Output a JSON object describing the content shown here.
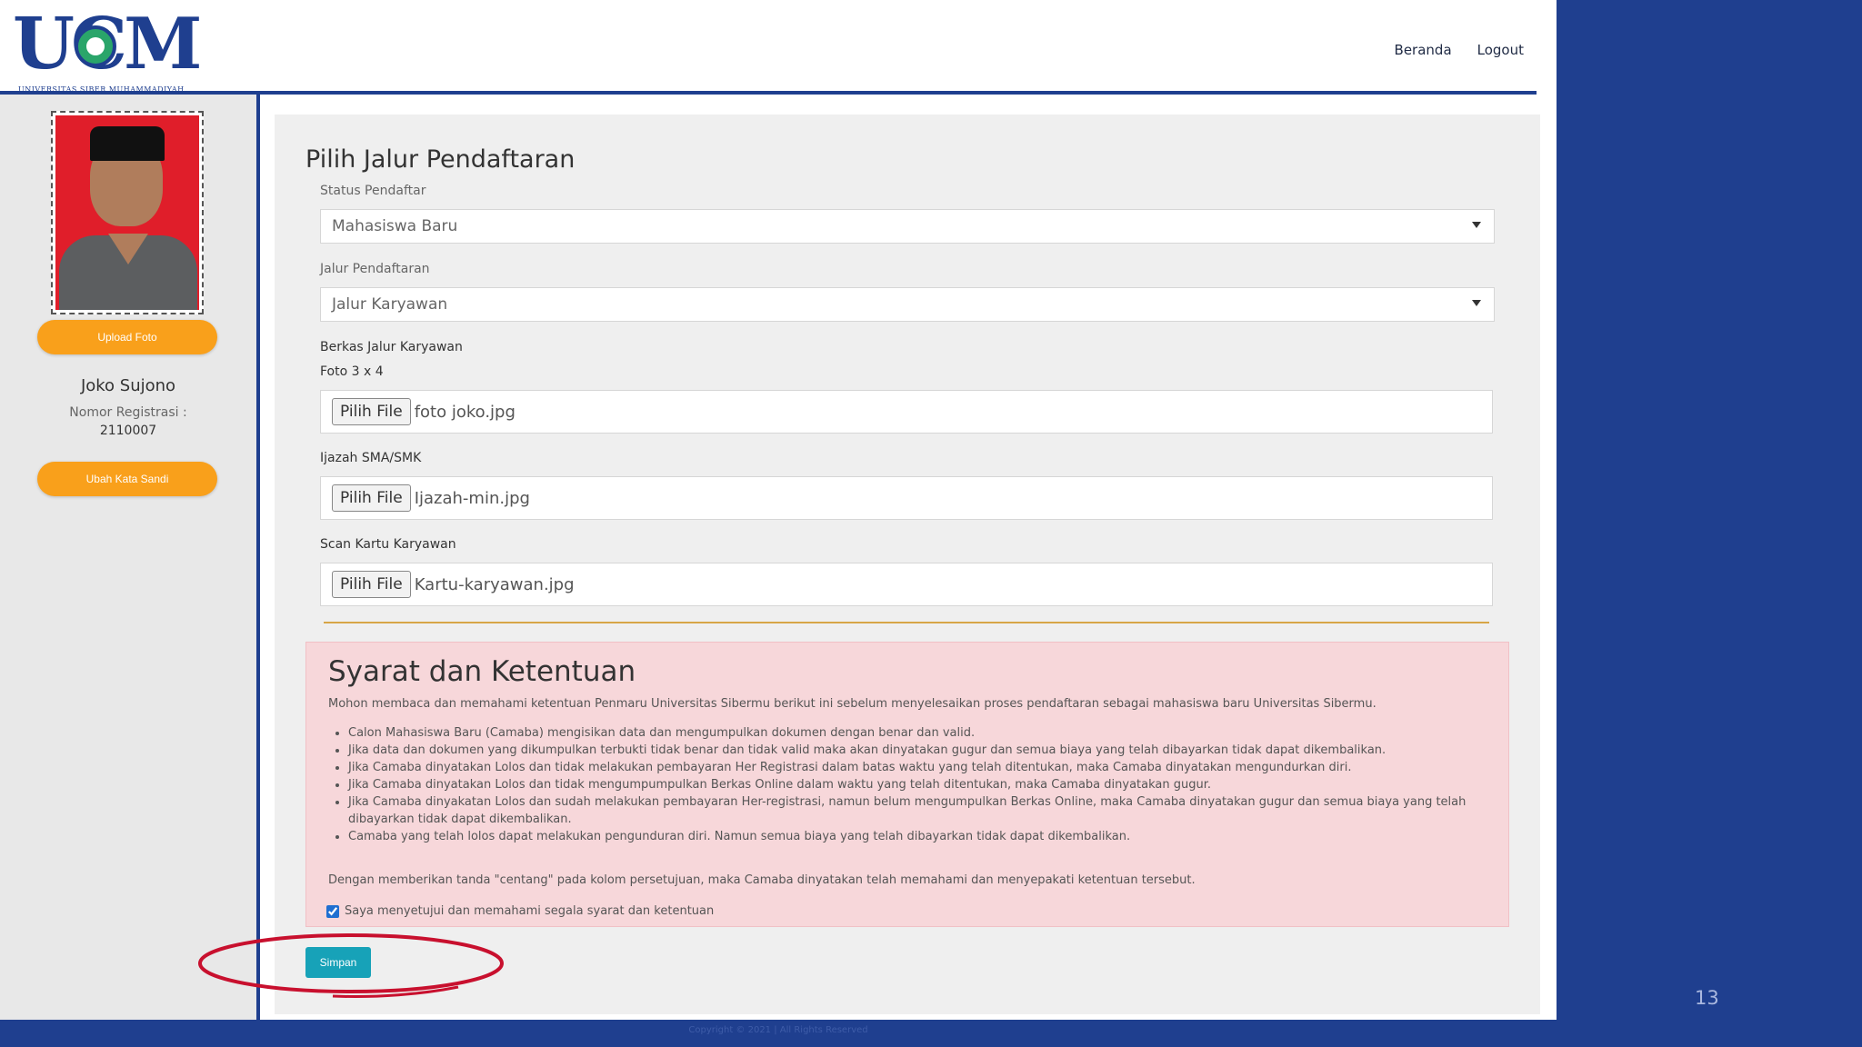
{
  "header": {
    "logo_text": "UCM",
    "logo_sub": "UNIVERSITAS SIBER MUHAMMADIYAH",
    "nav": [
      "Beranda",
      "Logout"
    ]
  },
  "sidebar": {
    "upload_label": "Upload Foto",
    "user_name": "Joko Sujono",
    "reg_label": "Nomor Registrasi :",
    "reg_value": "2110007",
    "change_password_label": "Ubah Kata Sandi"
  },
  "form": {
    "title": "Pilih Jalur Pendaftaran",
    "status_label": "Status Pendaftar",
    "status_value": "Mahasiswa Baru",
    "path_label": "Jalur Pendaftaran",
    "path_value": "Jalur Karyawan",
    "files_heading": "Berkas Jalur Karyawan",
    "files": [
      {
        "label": "Foto 3 x 4",
        "button": "Pilih File",
        "filename": "foto joko.jpg"
      },
      {
        "label": "Ijazah SMA/SMK",
        "button": "Pilih File",
        "filename": "Ijazah-min.jpg"
      },
      {
        "label": "Scan Kartu Karyawan",
        "button": "Pilih File",
        "filename": "Kartu-karyawan.jpg"
      }
    ]
  },
  "terms": {
    "title": "Syarat dan Ketentuan",
    "intro": "Mohon membaca dan memahami ketentuan Penmaru Universitas Sibermu berikut ini sebelum menyelesaikan proses pendaftaran sebagai mahasiswa baru Universitas Sibermu.",
    "items": [
      "Calon Mahasiswa Baru (Camaba) mengisikan data dan mengumpulkan dokumen dengan benar dan valid.",
      "Jika data dan dokumen yang dikumpulkan terbukti tidak benar dan tidak valid maka akan dinyatakan gugur dan semua biaya yang telah dibayarkan tidak dapat dikembalikan.",
      "Jika Camaba dinyatakan Lolos dan tidak melakukan pembayaran Her Registrasi dalam batas waktu yang telah ditentukan, maka Camaba dinyatakan mengundurkan diri.",
      "Jika Camaba dinyatakan Lolos dan tidak mengumpumpulkan Berkas Online dalam waktu yang telah ditentukan, maka Camaba dinyatakan gugur.",
      "Jika Camaba dinyakatan Lolos dan sudah melakukan pembayaran Her-registrasi, namun belum mengumpulkan Berkas Online, maka Camaba dinyatakan gugur dan semua biaya yang telah dibayarkan tidak dapat dikembalikan.",
      "Camaba yang telah lolos dapat melakukan pengunduran diri. Namun semua biaya yang telah dibayarkan tidak dapat dikembalikan."
    ],
    "closing": "Dengan memberikan tanda \"centang\" pada kolom persetujuan, maka Camaba dinyatakan telah memahami dan menyepakati ketentuan tersebut.",
    "agree_label": "Saya menyetujui dan memahami segala syarat dan ketentuan",
    "agreed": true
  },
  "actions": {
    "save_label": "Simpan"
  },
  "footer": {
    "text": "Copyright © 2021 | All Rights Reserved"
  },
  "slide": {
    "number": "13"
  },
  "colors": {
    "brand_blue": "#1f3f8f",
    "orange": "#f9a01b",
    "teal": "#17a2b8",
    "terms_bg": "#f7d7da",
    "annotation_red": "#c8102e"
  }
}
